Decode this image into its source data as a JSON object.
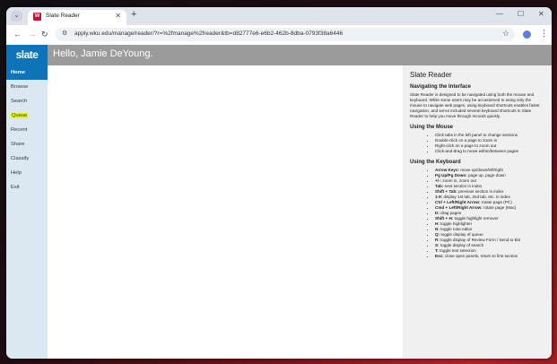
{
  "browser": {
    "tab_title": "Slate Reader",
    "tab_favicon": "W",
    "url": "apply.wku.edu/manage/reader/?r=%2fmanage%2freader&tb=d82777e6-e6b2-462b-8dba-0793f38a6446",
    "icons": {
      "dropdown": "⌄",
      "close": "✕",
      "new_tab": "+",
      "minimize": "—",
      "maximize": "☐",
      "win_close": "✕",
      "back": "←",
      "forward": "→",
      "reload": "↻",
      "site_info": "⚙",
      "star": "☆",
      "profile": "👤",
      "menu": "⋮"
    }
  },
  "app": {
    "logo": "slate",
    "greeting": "Hello, Jamie DeYoung.",
    "colors": {
      "accent": "#0f73b8",
      "header": "#9b9b9b",
      "sidebar": "#dbe7f1",
      "highlight": "#e8f21b"
    }
  },
  "sidebar": {
    "items": [
      {
        "label": "Home"
      },
      {
        "label": "Browse"
      },
      {
        "label": "Search"
      },
      {
        "label": "Queue"
      },
      {
        "label": "Recent"
      },
      {
        "label": "Share"
      },
      {
        "label": "Classify"
      },
      {
        "label": "Help"
      },
      {
        "label": "Exit"
      }
    ]
  },
  "help": {
    "title": "Slate Reader",
    "nav_heading": "Navigating the Interface",
    "nav_text": "Slate Reader is designed to be navigated using both the mouse and keyboard. While some users may be accustomed to using only the mouse to navigate web pages, using keyboard shortcuts enables faster navigation, and we've included several keyboard shortcuts in Slate Reader to help you move through records quickly.",
    "mouse_heading": "Using the Mouse",
    "mouse_items": [
      "Click tabs in the left panel to change sections",
      "Double-click on a page to zoom in",
      "Right-click on a page to zoom out",
      "Click-and-drag to move within/between pages"
    ],
    "keyboard_heading": "Using the Keyboard",
    "keyboard_items": [
      {
        "key": "Arrow Keys:",
        "desc": " move up/down/left/right"
      },
      {
        "key": "Pg Up/Pg Down:",
        "desc": " page up, page down"
      },
      {
        "key": "+/-:",
        "desc": " zoom in, zoom out"
      },
      {
        "key": "Tab:",
        "desc": " next section in index"
      },
      {
        "key": "Shift + Tab:",
        "desc": " previous section in index"
      },
      {
        "key": "1-9:",
        "desc": " display 1st tab, 2nd tab, etc. in index"
      },
      {
        "key": "Ctrl + Left/Right Arrow:",
        "desc": " rotate page (PC)"
      },
      {
        "key": "Cmd + Left/Right Arrow:",
        "desc": " rotate page (Mac)"
      },
      {
        "key": "D:",
        "desc": " drag pages"
      },
      {
        "key": "Shift + H:",
        "desc": " toggle highlight remover"
      },
      {
        "key": "H:",
        "desc": " toggle highlighter"
      },
      {
        "key": "N:",
        "desc": " toggle note editor"
      },
      {
        "key": "Q:",
        "desc": " toggle display of queue"
      },
      {
        "key": "R:",
        "desc": " toggle display of Review Form / Send to Bin"
      },
      {
        "key": "S:",
        "desc": " toggle display of search"
      },
      {
        "key": "T:",
        "desc": " toggle text selection"
      },
      {
        "key": "Esc:",
        "desc": " close open panels, return to first section"
      }
    ]
  }
}
